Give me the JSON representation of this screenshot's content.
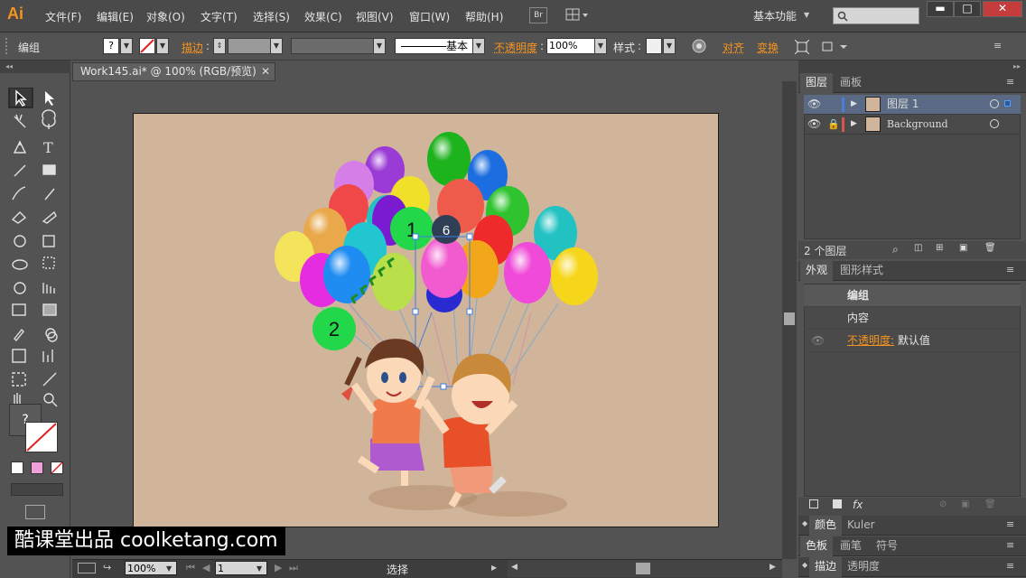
{
  "app": {
    "logo": "Ai"
  },
  "menubar": {
    "items": [
      "文件(F)",
      "编辑(E)",
      "对象(O)",
      "文字(T)",
      "选择(S)",
      "效果(C)",
      "视图(V)",
      "窗口(W)",
      "帮助(H)"
    ],
    "bridge_label": "Br",
    "workspace": "基本功能",
    "search_placeholder": ""
  },
  "controlbar": {
    "selection_type": "编组",
    "stroke_label": "描边",
    "stroke_style": "基本",
    "opacity_label": "不透明度",
    "opacity_value": "100%",
    "style_label": "样式",
    "align_label": "对齐",
    "transform_label": "变换"
  },
  "document": {
    "tab_title": "Work145.ai* @ 100% (RGB/预览)"
  },
  "canvas": {
    "markers": [
      "1",
      "2",
      "6"
    ]
  },
  "statusbar": {
    "zoom": "100%",
    "page": "1",
    "tool": "选择"
  },
  "layers_panel": {
    "tabs": [
      "图层",
      "画板"
    ],
    "layers": [
      {
        "name": "图层 1",
        "color": "#4f7bd9"
      },
      {
        "name": "Background",
        "color": "#d9564f"
      }
    ],
    "count": "2 个图层"
  },
  "appearance_panel": {
    "tabs": [
      "外观",
      "图形样式"
    ],
    "group_label": "编组",
    "content_label": "内容",
    "opacity_label": "不透明度:",
    "opacity_value": "默认值"
  },
  "collapsed_panels": [
    {
      "tabs": [
        "颜色",
        "Kuler"
      ]
    },
    {
      "tabs": [
        "色板",
        "画笔",
        "符号"
      ]
    },
    {
      "tabs": [
        "描边",
        "透明度"
      ]
    }
  ],
  "watermark": "酷课堂出品 coolketang.com",
  "colors": {
    "accent": "#f7941d",
    "artboard": "#d1b59a"
  }
}
